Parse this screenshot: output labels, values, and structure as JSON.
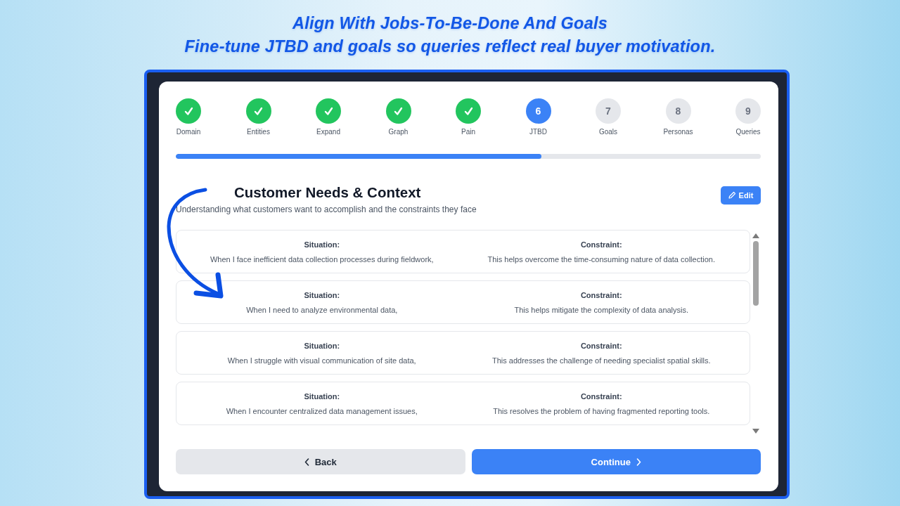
{
  "banner": {
    "title": "Align With Jobs-To-Be-Done And Goals",
    "subtitle": "Fine-tune JTBD and goals so queries reflect real buyer motivation."
  },
  "stepper": {
    "steps": [
      {
        "label": "Domain",
        "completed": true,
        "selected": false
      },
      {
        "label": "Entities",
        "completed": true,
        "selected": false
      },
      {
        "label": "Expand",
        "completed": true,
        "selected": false
      },
      {
        "label": "Graph",
        "completed": true,
        "selected": false
      },
      {
        "label": "Pain",
        "completed": true,
        "selected": false
      },
      {
        "label": "JTBD",
        "completed": false,
        "selected": true,
        "number": "6"
      },
      {
        "label": "Goals",
        "completed": false,
        "selected": false,
        "number": "7"
      },
      {
        "label": "Personas",
        "completed": false,
        "selected": false,
        "number": "8"
      },
      {
        "label": "Queries",
        "completed": false,
        "selected": false,
        "number": "9"
      }
    ],
    "progress": {
      "level": 0.625
    }
  },
  "section": {
    "title": "Customer Needs & Context",
    "description": "Understanding what customers want to accomplish and the constraints they face",
    "edit_button": "Edit"
  },
  "needs": {
    "rows": [
      {
        "situation_label": "Situation:",
        "situation": "When I face inefficient data collection processes during fieldwork,",
        "constraint_label": "Constraint:",
        "constraint": "This helps overcome the time-consuming nature of data collection."
      },
      {
        "situation_label": "Situation:",
        "situation": "When I need to analyze environmental data,",
        "constraint_label": "Constraint:",
        "constraint": "This helps mitigate the complexity of data analysis."
      },
      {
        "situation_label": "Situation:",
        "situation": "When I struggle with visual communication of site data,",
        "constraint_label": "Constraint:",
        "constraint": "This addresses the challenge of needing specialist spatial skills."
      },
      {
        "situation_label": "Situation:",
        "situation": "When I encounter centralized data management issues,",
        "constraint_label": "Constraint:",
        "constraint": "This resolves the problem of having fragmented reporting tools."
      }
    ]
  },
  "footer": {
    "back_button": "Back",
    "continue_button": "Continue"
  }
}
